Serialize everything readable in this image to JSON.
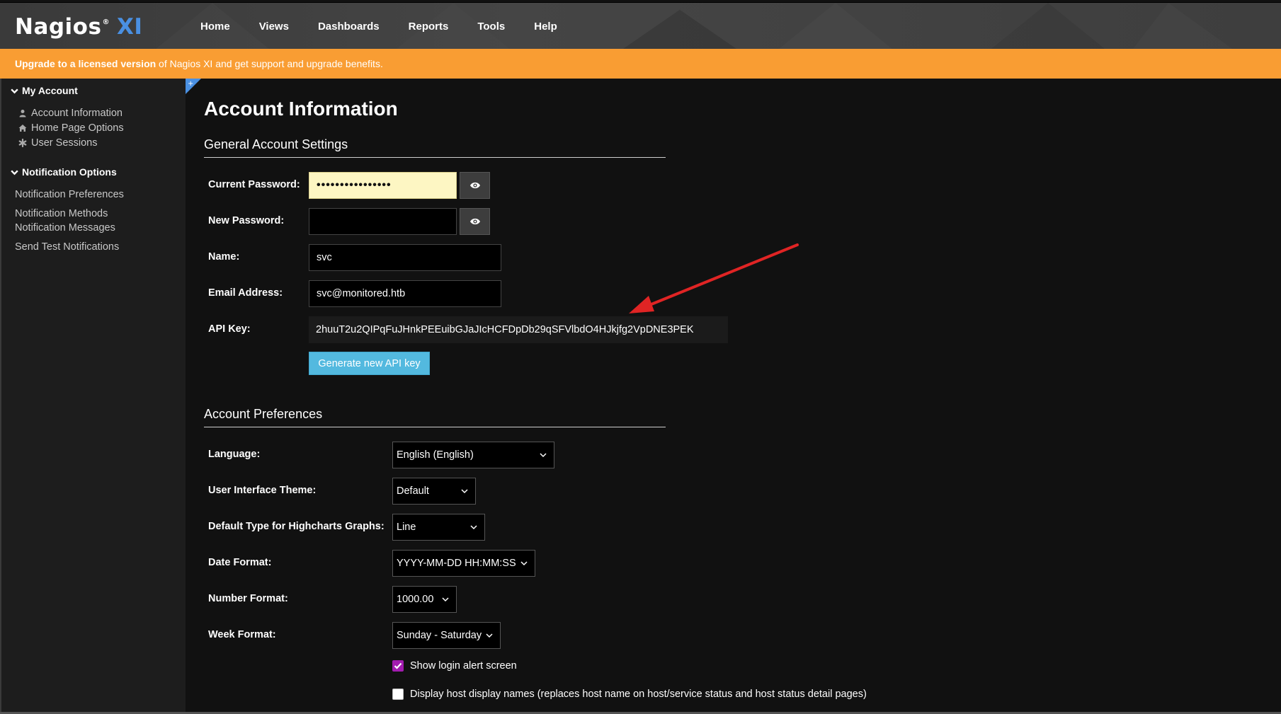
{
  "app": {
    "logo_main": "Nagios",
    "logo_reg": "®",
    "logo_suffix": "XI"
  },
  "nav": {
    "items": [
      "Home",
      "Views",
      "Dashboards",
      "Reports",
      "Tools",
      "Help"
    ]
  },
  "banner": {
    "bold": "Upgrade to a licensed version",
    "rest": " of Nagios XI and get support and upgrade benefits."
  },
  "sidebar": {
    "my_account": {
      "title": "My Account",
      "links": [
        {
          "label": "Account Information",
          "icon": "user-icon"
        },
        {
          "label": "Home Page Options",
          "icon": "home-icon"
        },
        {
          "label": "User Sessions",
          "icon": "asterisk-icon"
        }
      ]
    },
    "notification_options": {
      "title": "Notification Options",
      "links": [
        {
          "label": "Notification Preferences"
        },
        {
          "label": "Notification Methods"
        },
        {
          "label": "Notification Messages"
        },
        {
          "label": "Send Test Notifications"
        }
      ]
    }
  },
  "page": {
    "title": "Account Information",
    "general": {
      "title": "General Account Settings",
      "current_password_label": "Current Password:",
      "current_password_value": "••••••••••••••••",
      "new_password_label": "New Password:",
      "new_password_value": "",
      "name_label": "Name:",
      "name_value": "svc",
      "email_label": "Email Address:",
      "email_value": "svc@monitored.htb",
      "api_key_label": "API Key:",
      "api_key_value": "2huuT2u2QIPqFuJHnkPEEuibGJaJIcHCFDpDb29qSFVlbdO4HJkjfg2VpDNE3PEK",
      "generate_button": "Generate new API key"
    },
    "preferences": {
      "title": "Account Preferences",
      "language_label": "Language:",
      "language_value": "English (English)",
      "theme_label": "User Interface Theme:",
      "theme_value": "Default",
      "graph_label": "Default Type for Highcharts Graphs:",
      "graph_value": "Line",
      "date_label": "Date Format:",
      "date_value": "YYYY-MM-DD HH:MM:SS",
      "number_label": "Number Format:",
      "number_value": "1000.00",
      "week_label": "Week Format:",
      "week_value": "Sunday - Saturday",
      "show_login_alert": {
        "label": "Show login alert screen",
        "checked": true
      },
      "display_host_names": {
        "label": "Display host display names (replaces host name on host/service status and host status detail pages)",
        "checked": false
      }
    }
  },
  "colors": {
    "banner": "#f99d33",
    "accent_button": "#53b9df",
    "checkbox_on": "#a21caf",
    "annotation_arrow": "#e02424",
    "logo_xi": "#4a90e2"
  }
}
